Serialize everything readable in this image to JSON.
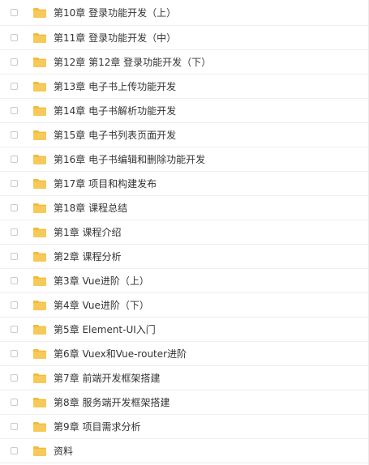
{
  "colors": {
    "folder_fill": "#f7c95a",
    "folder_tab": "#f2bb3c",
    "text": "#333333",
    "divider": "#eeeeee",
    "checkbox_border": "#c9c9c9"
  },
  "file_list": {
    "items": [
      {
        "label": "第10章 登录功能开发（上）",
        "icon": "folder-icon"
      },
      {
        "label": "第11章 登录功能开发（中）",
        "icon": "folder-icon"
      },
      {
        "label": "第12章 第12章 登录功能开发（下）",
        "icon": "folder-icon"
      },
      {
        "label": "第13章 电子书上传功能开发",
        "icon": "folder-icon"
      },
      {
        "label": "第14章 电子书解析功能开发",
        "icon": "folder-icon"
      },
      {
        "label": "第15章 电子书列表页面开发",
        "icon": "folder-icon"
      },
      {
        "label": "第16章 电子书编辑和删除功能开发",
        "icon": "folder-icon"
      },
      {
        "label": "第17章 项目和构建发布",
        "icon": "folder-icon"
      },
      {
        "label": "第18章 课程总结",
        "icon": "folder-icon"
      },
      {
        "label": "第1章 课程介绍",
        "icon": "folder-icon"
      },
      {
        "label": "第2章 课程分析",
        "icon": "folder-icon"
      },
      {
        "label": "第3章 Vue进阶（上）",
        "icon": "folder-icon"
      },
      {
        "label": "第4章 Vue进阶（下）",
        "icon": "folder-icon"
      },
      {
        "label": "第5章 Element-UI入门",
        "icon": "folder-icon"
      },
      {
        "label": "第6章 Vuex和Vue-router进阶",
        "icon": "folder-icon"
      },
      {
        "label": "第7章 前端开发框架搭建",
        "icon": "folder-icon"
      },
      {
        "label": "第8章 服务端开发框架搭建",
        "icon": "folder-icon"
      },
      {
        "label": "第9章 项目需求分析",
        "icon": "folder-icon"
      },
      {
        "label": "资料",
        "icon": "folder-icon"
      }
    ]
  }
}
